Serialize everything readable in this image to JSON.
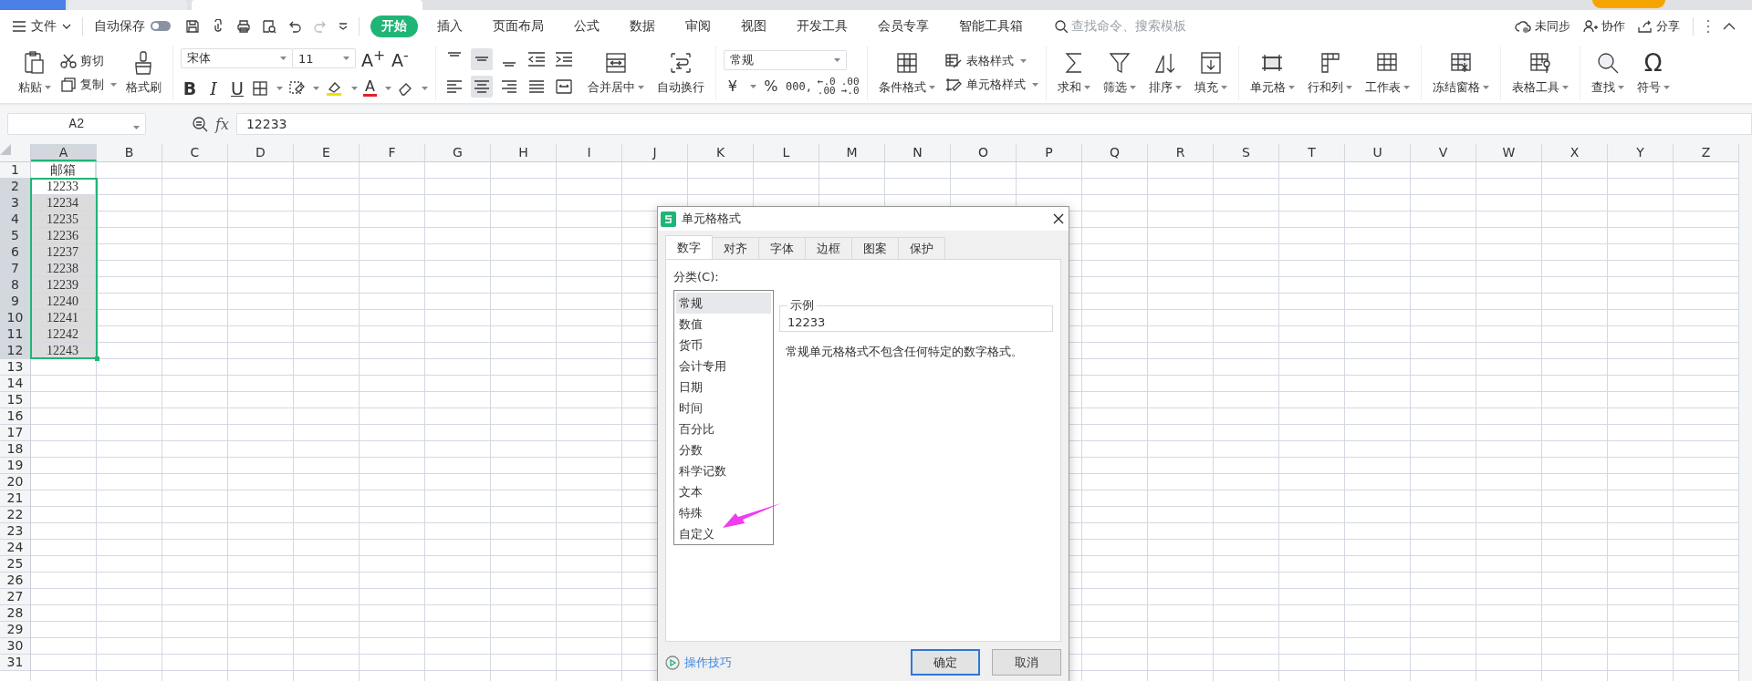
{
  "menu": {
    "file": "文件",
    "autosave": {
      "label": "自动保存",
      "on": false
    },
    "tabs": [
      {
        "label": "开始",
        "selected": true
      },
      {
        "label": "插入",
        "selected": false
      },
      {
        "label": "页面布局",
        "selected": false
      },
      {
        "label": "公式",
        "selected": false
      },
      {
        "label": "数据",
        "selected": false
      },
      {
        "label": "审阅",
        "selected": false
      },
      {
        "label": "视图",
        "selected": false
      },
      {
        "label": "开发工具",
        "selected": false
      },
      {
        "label": "会员专享",
        "selected": false
      },
      {
        "label": "智能工具箱",
        "selected": false
      }
    ],
    "search": {
      "placeholder": "查找命令、搜索模板"
    },
    "sync": "未同步",
    "collaborate": "协作",
    "share": "分享"
  },
  "ribbon": {
    "paste": "粘贴",
    "cut": "剪切",
    "copy": "复制",
    "format_painter": "格式刷",
    "font_name": "宋体",
    "font_size": "11",
    "grow_font": "A$^{+}$",
    "shrink_font": "A$^{-}$",
    "bold": "B",
    "italic": "I",
    "underline": "U",
    "font_color": "A",
    "vertical_align": [
      {
        "selected": false
      },
      {
        "selected": true
      },
      {
        "selected": false
      }
    ],
    "horizontal_align": [
      {
        "selected": false
      },
      {
        "selected": true
      },
      {
        "selected": false
      }
    ],
    "merge": "合并居中",
    "wrap": "自动换行",
    "number_format": "常规",
    "currency": "¥",
    "percent": "%",
    "thousands": "000,",
    "increase_decimal": [
      "←.0",
      ".00"
    ],
    "decrease_decimal": [
      ".00",
      "→.0"
    ],
    "conditional_format": "条件格式",
    "table_style": "表格样式",
    "cell_style": "单元格样式",
    "sum": "求和",
    "filter": "筛选",
    "sort": "排序",
    "fill": "填充",
    "cells": "单元格",
    "rows_cols": "行和列",
    "sheet": "工作表",
    "freeze": "冻结窗格",
    "table_tools": "表格工具",
    "find": "查找",
    "symbol": "符号",
    "symbol_glyph": "Ω"
  },
  "formula_bar": {
    "name_box": "A2",
    "fx": "fx",
    "value": "12233"
  },
  "sheet": {
    "columns": [
      {
        "label": "A",
        "selected": true
      },
      {
        "label": "B",
        "selected": false
      },
      {
        "label": "C",
        "selected": false
      },
      {
        "label": "D",
        "selected": false
      },
      {
        "label": "E",
        "selected": false
      },
      {
        "label": "F",
        "selected": false
      },
      {
        "label": "G",
        "selected": false
      },
      {
        "label": "H",
        "selected": false
      },
      {
        "label": "I",
        "selected": false
      },
      {
        "label": "J",
        "selected": false
      },
      {
        "label": "K",
        "selected": false
      },
      {
        "label": "L",
        "selected": false
      },
      {
        "label": "M",
        "selected": false
      },
      {
        "label": "N",
        "selected": false
      },
      {
        "label": "O",
        "selected": false
      },
      {
        "label": "P",
        "selected": false
      },
      {
        "label": "Q",
        "selected": false
      },
      {
        "label": "R",
        "selected": false
      },
      {
        "label": "S",
        "selected": false
      },
      {
        "label": "T",
        "selected": false
      },
      {
        "label": "U",
        "selected": false
      },
      {
        "label": "V",
        "selected": false
      },
      {
        "label": "W",
        "selected": false
      },
      {
        "label": "X",
        "selected": false
      },
      {
        "label": "Y",
        "selected": false
      },
      {
        "label": "Z",
        "selected": false
      }
    ],
    "rows": [
      {
        "number": "1",
        "selected": false,
        "cells": [
          "邮箱"
        ]
      },
      {
        "number": "2",
        "selected": true,
        "cells": [
          "12233"
        ]
      },
      {
        "number": "3",
        "selected": true,
        "cells": [
          "12234"
        ]
      },
      {
        "number": "4",
        "selected": true,
        "cells": [
          "12235"
        ]
      },
      {
        "number": "5",
        "selected": true,
        "cells": [
          "12236"
        ]
      },
      {
        "number": "6",
        "selected": true,
        "cells": [
          "12237"
        ]
      },
      {
        "number": "7",
        "selected": true,
        "cells": [
          "12238"
        ]
      },
      {
        "number": "8",
        "selected": true,
        "cells": [
          "12239"
        ]
      },
      {
        "number": "9",
        "selected": true,
        "cells": [
          "12240"
        ]
      },
      {
        "number": "10",
        "selected": true,
        "cells": [
          "12241"
        ]
      },
      {
        "number": "11",
        "selected": true,
        "cells": [
          "12242"
        ]
      },
      {
        "number": "12",
        "selected": true,
        "cells": [
          "12243"
        ]
      },
      {
        "number": "13",
        "selected": false
      },
      {
        "number": "14",
        "selected": false
      },
      {
        "number": "15",
        "selected": false
      },
      {
        "number": "16",
        "selected": false
      },
      {
        "number": "17",
        "selected": false
      },
      {
        "number": "18",
        "selected": false
      },
      {
        "number": "19",
        "selected": false
      },
      {
        "number": "20",
        "selected": false
      },
      {
        "number": "21",
        "selected": false
      },
      {
        "number": "22",
        "selected": false
      },
      {
        "number": "23",
        "selected": false
      },
      {
        "number": "24",
        "selected": false
      },
      {
        "number": "25",
        "selected": false
      },
      {
        "number": "26",
        "selected": false
      },
      {
        "number": "27",
        "selected": false
      },
      {
        "number": "28",
        "selected": false
      },
      {
        "number": "29",
        "selected": false
      },
      {
        "number": "30",
        "selected": false
      },
      {
        "number": "31",
        "selected": false
      }
    ]
  },
  "dialog": {
    "title": "单元格格式",
    "tabs": [
      {
        "label": "数字",
        "selected": true
      },
      {
        "label": "对齐",
        "selected": false
      },
      {
        "label": "字体",
        "selected": false
      },
      {
        "label": "边框",
        "selected": false
      },
      {
        "label": "图案",
        "selected": false
      },
      {
        "label": "保护",
        "selected": false
      }
    ],
    "category_label": "分类(C):",
    "categories": [
      {
        "label": "常规",
        "selected": true
      },
      {
        "label": "数值",
        "selected": false
      },
      {
        "label": "货币",
        "selected": false
      },
      {
        "label": "会计专用",
        "selected": false
      },
      {
        "label": "日期",
        "selected": false
      },
      {
        "label": "时间",
        "selected": false
      },
      {
        "label": "百分比",
        "selected": false
      },
      {
        "label": "分数",
        "selected": false
      },
      {
        "label": "科学记数",
        "selected": false
      },
      {
        "label": "文本",
        "selected": false
      },
      {
        "label": "特殊",
        "selected": false
      },
      {
        "label": "自定义",
        "selected": false
      }
    ],
    "sample": {
      "legend": "示例",
      "value": "12233"
    },
    "description": "常规单元格格式不包含任何特定的数字格式。",
    "tips_link": "操作技巧",
    "buttons": [
      {
        "label": "确定",
        "kind": "primary"
      },
      {
        "label": "取消",
        "kind": "secondary"
      }
    ]
  }
}
